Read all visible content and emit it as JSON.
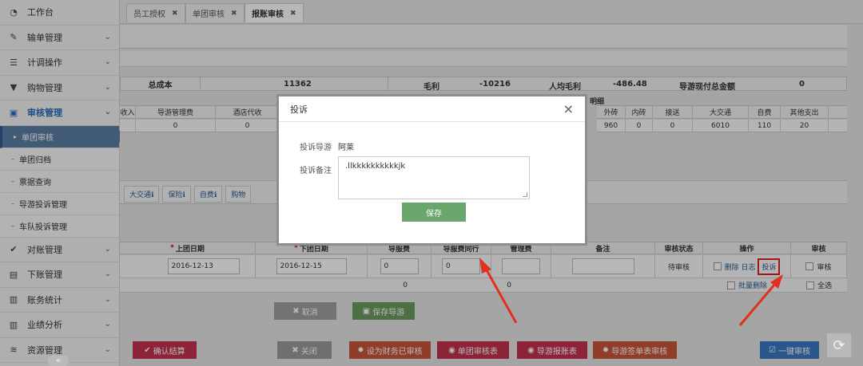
{
  "sidebar": {
    "items": [
      {
        "label": "工作台",
        "icon": "dashboard-icon",
        "glyph": "◔"
      },
      {
        "label": "输单管理",
        "icon": "edit-icon",
        "glyph": "✎"
      },
      {
        "label": "计调操作",
        "icon": "list-icon",
        "glyph": "☰"
      },
      {
        "label": "购物管理",
        "icon": "cart-icon",
        "glyph": "▼"
      },
      {
        "label": "审核管理",
        "icon": "lock-icon",
        "glyph": "▣"
      }
    ],
    "subitems": [
      "单团审核",
      "单团归档",
      "票据查询",
      "导游投诉管理",
      "车队投诉管理"
    ],
    "items_after": [
      {
        "label": "对账管理",
        "icon": "check-icon",
        "glyph": "✔"
      },
      {
        "label": "下账管理",
        "icon": "money-icon",
        "glyph": "▤"
      },
      {
        "label": "账务统计",
        "icon": "book-icon",
        "glyph": "▥"
      },
      {
        "label": "业绩分析",
        "icon": "bar-chart-icon",
        "glyph": "▥"
      },
      {
        "label": "资源管理",
        "icon": "database-icon",
        "glyph": "≋"
      }
    ]
  },
  "tabs": [
    {
      "label": "员工授权"
    },
    {
      "label": "单团审核"
    },
    {
      "label": "报账审核"
    }
  ],
  "summary": {
    "cost_label": "总成本",
    "cost_value": "11362",
    "profit_label": "毛利",
    "profit_value": "-10216",
    "per_capita_label": "人均毛利",
    "per_capita_value": "-486.48",
    "guide_cash_label": "导游现付总金额",
    "guide_cash_value": "0"
  },
  "detail_title": "明细",
  "expense_table": {
    "left_headers": [
      "收入",
      "导游管理费",
      "酒店代收"
    ],
    "left_values": [
      "",
      "0",
      "0"
    ],
    "right_headers": [
      "外砖",
      "内砖",
      "接送",
      "大交通",
      "自费",
      "其他支出"
    ],
    "right_values": [
      "960",
      "0",
      "0",
      "6010",
      "110",
      "20"
    ]
  },
  "subtabs": [
    "大交通ℹ",
    "保险ℹ",
    "自费ℹ",
    "购物"
  ],
  "grid": {
    "headers": [
      "上团日期",
      "下团日期",
      "导服费",
      "导服费同行",
      "管理费",
      "备注",
      "审核状态",
      "操作",
      "审核"
    ],
    "row": {
      "start_date": "2016-12-13",
      "end_date": "2016-12-15",
      "guide_fee": "0",
      "peer_fee": "0",
      "mgmt_fee": "",
      "status": "待审核",
      "delete": "删除",
      "log": "日志",
      "complaint": "投诉",
      "audit": "审核"
    },
    "totals": {
      "guide_fee_total": "0",
      "mgmt_total": "0",
      "batch_delete": "批量删除",
      "select_all": "全选"
    }
  },
  "actions_mid": {
    "cancel": "取消",
    "save_guide": "保存导游"
  },
  "footer_buttons": {
    "confirm": "确认结算",
    "close": "关闭",
    "set_finance": "设为财务已审核",
    "audit_sheet": "单团审核表",
    "guide_report": "导游报账表",
    "guide_sign": "导游签单表审核",
    "one_click": "一键审核"
  },
  "modal": {
    "title": "投诉",
    "guide_label": "投诉导游",
    "guide_value": "阿莱",
    "note_label": "投诉备注",
    "note_value": ".llkkkkkkkkkkjk",
    "save": "保存"
  },
  "colors": {
    "accent": "#2a6ebb",
    "danger": "#c0392b",
    "save_green": "#6aa56b",
    "arrow_red": "#e0301e"
  }
}
